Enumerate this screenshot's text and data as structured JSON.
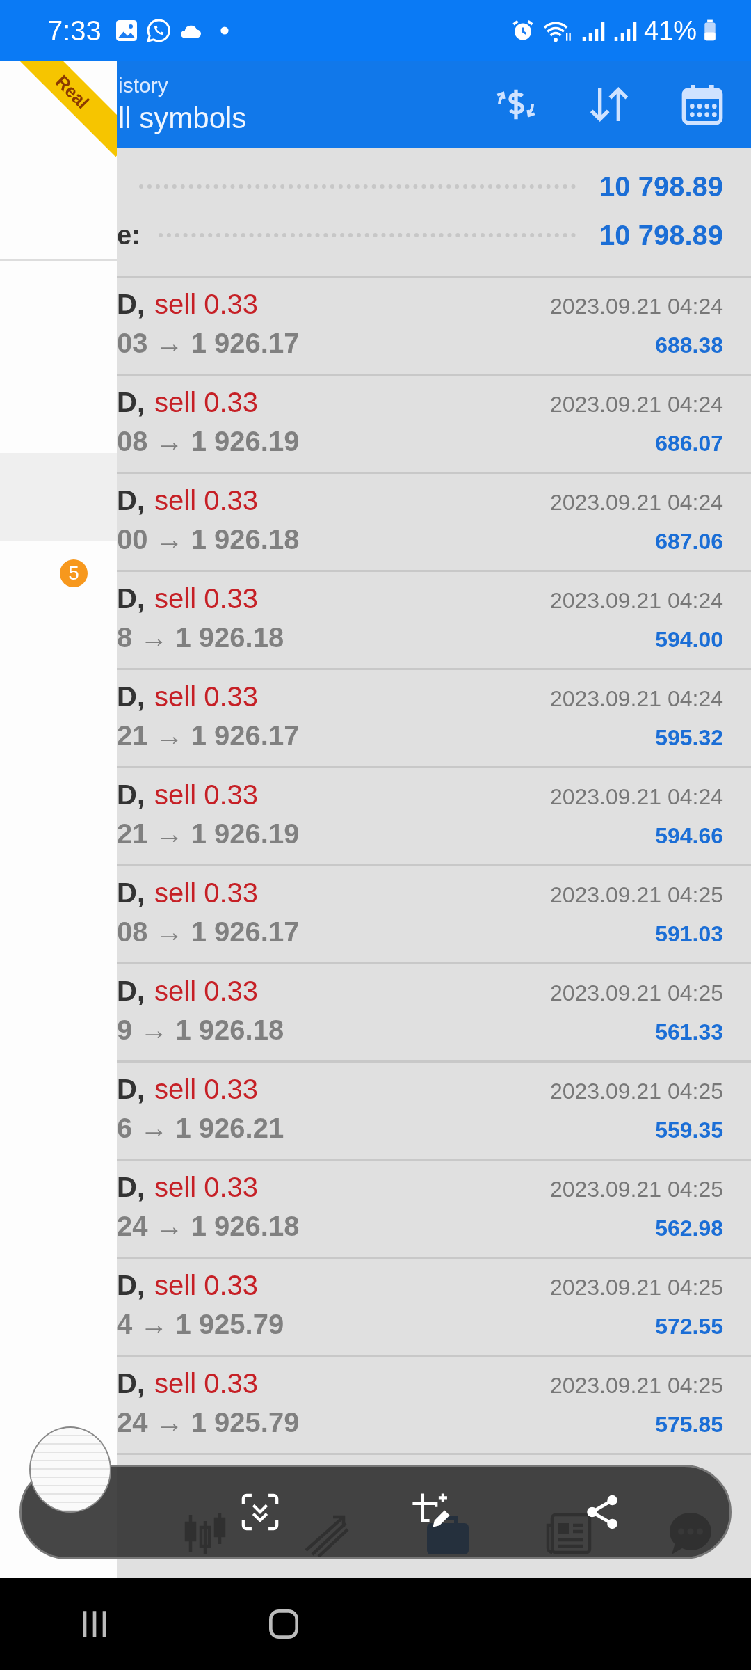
{
  "status_bar": {
    "time": "7:33",
    "battery": "41%"
  },
  "app_bar": {
    "subtitle": "istory",
    "title": "ll symbols"
  },
  "ribbon": "Real",
  "drawer": {
    "badge": "5"
  },
  "summary": [
    {
      "value": "10 798.89"
    },
    {
      "label": "e:",
      "value": "10 798.89"
    }
  ],
  "deals": [
    {
      "symbol": "D,",
      "order": "sell 0.33",
      "prices": "03 → 1 926.17",
      "time": "2023.09.21 04:24",
      "profit": "688.38"
    },
    {
      "symbol": "D,",
      "order": "sell 0.33",
      "prices": "08 → 1 926.19",
      "time": "2023.09.21 04:24",
      "profit": "686.07"
    },
    {
      "symbol": "D,",
      "order": "sell 0.33",
      "prices": "00 → 1 926.18",
      "time": "2023.09.21 04:24",
      "profit": "687.06"
    },
    {
      "symbol": "D,",
      "order": "sell 0.33",
      "prices": "8 → 1 926.18",
      "time": "2023.09.21 04:24",
      "profit": "594.00"
    },
    {
      "symbol": "D,",
      "order": "sell 0.33",
      "prices": "21 → 1 926.17",
      "time": "2023.09.21 04:24",
      "profit": "595.32"
    },
    {
      "symbol": "D,",
      "order": "sell 0.33",
      "prices": "21 → 1 926.19",
      "time": "2023.09.21 04:24",
      "profit": "594.66"
    },
    {
      "symbol": "D,",
      "order": "sell 0.33",
      "prices": "08 → 1 926.17",
      "time": "2023.09.21 04:25",
      "profit": "591.03"
    },
    {
      "symbol": "D,",
      "order": "sell 0.33",
      "prices": "9 → 1 926.18",
      "time": "2023.09.21 04:25",
      "profit": "561.33"
    },
    {
      "symbol": "D,",
      "order": "sell 0.33",
      "prices": "6 → 1 926.21",
      "time": "2023.09.21 04:25",
      "profit": "559.35"
    },
    {
      "symbol": "D,",
      "order": "sell 0.33",
      "prices": "24 → 1 926.18",
      "time": "2023.09.21 04:25",
      "profit": "562.98"
    },
    {
      "symbol": "D,",
      "order": "sell 0.33",
      "prices": "4 → 1 925.79",
      "time": "2023.09.21 04:25",
      "profit": "572.55"
    },
    {
      "symbol": "D,",
      "order": "sell 0.33",
      "prices": "24 → 1 925.79",
      "time": "2023.09.21 04:25",
      "profit": "575.85"
    }
  ]
}
